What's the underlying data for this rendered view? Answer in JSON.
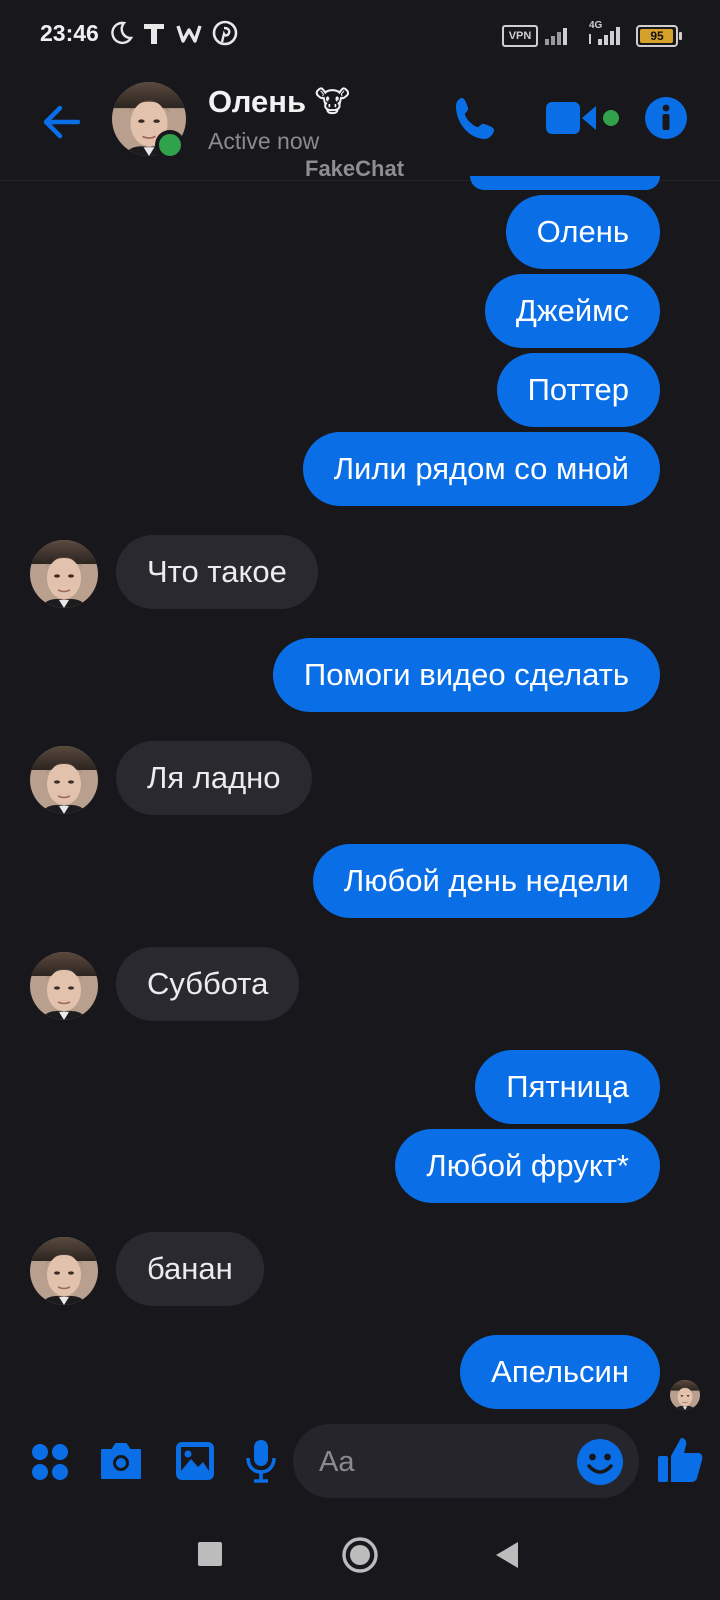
{
  "status_bar": {
    "time": "23:46",
    "icons": [
      "moon-icon",
      "t-app-icon",
      "w-app-icon",
      "pinterest-icon"
    ],
    "vpn_label": "VPN",
    "network_label": "4G",
    "battery_level": "95"
  },
  "header": {
    "back_icon": "arrow-left-icon",
    "contact_name": "Олень",
    "contact_emoji": "🐮",
    "presence": "Active now",
    "watermark": "FakeChat",
    "actions": [
      "phone-icon",
      "video-icon",
      "info-icon"
    ],
    "accent_color": "#0a6fe6",
    "online_color": "#31a24c"
  },
  "messages": [
    {
      "side": "out",
      "text": "Олень"
    },
    {
      "side": "out",
      "text": "Джеймс"
    },
    {
      "side": "out",
      "text": "Поттер"
    },
    {
      "side": "out",
      "text": "Лили рядом со мной"
    },
    {
      "side": "in",
      "text": "Что такое"
    },
    {
      "side": "out",
      "text": "Помоги видео сделать"
    },
    {
      "side": "in",
      "text": "Ля ладно"
    },
    {
      "side": "out",
      "text": "Любой день недели"
    },
    {
      "side": "in",
      "text": "Суббота"
    },
    {
      "side": "out",
      "text": "Пятница"
    },
    {
      "side": "out",
      "text": "Любой фрукт*"
    },
    {
      "side": "in",
      "text": "банан"
    },
    {
      "side": "out",
      "text": "Апельсин"
    }
  ],
  "composer": {
    "icons": [
      "apps-icon",
      "camera-icon",
      "gallery-icon",
      "microphone-icon",
      "emoji-icon",
      "thumbs-up-icon"
    ],
    "placeholder": "Aa"
  },
  "nav_bar": {
    "icons": [
      "recents-square-icon",
      "home-circle-icon",
      "back-triangle-icon"
    ]
  },
  "colors": {
    "background": "#18171c",
    "outgoing_bubble": "#0a6fe6",
    "incoming_bubble": "#2a292f"
  }
}
